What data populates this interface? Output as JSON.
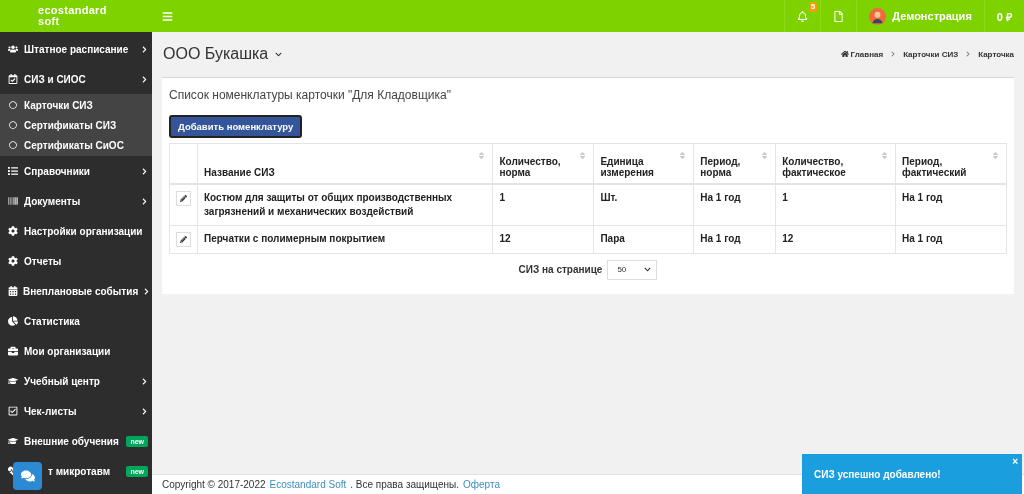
{
  "header": {
    "logo": [
      "ecostandard",
      "soft"
    ],
    "notifications_badge": "5",
    "user": "Демонстрация",
    "balance": "0 ₽"
  },
  "sidebar": {
    "items": [
      {
        "label": "Штатное расписание",
        "arrow": true
      },
      {
        "label": "СИЗ и СИОС",
        "arrow": true,
        "children": [
          {
            "label": "Карточки СИЗ"
          },
          {
            "label": "Сертификаты СИЗ"
          },
          {
            "label": "Сертификаты СиОС"
          }
        ]
      },
      {
        "label": "Справочники",
        "arrow": true
      },
      {
        "label": "Документы",
        "arrow": true
      },
      {
        "label": "Настройки организации",
        "arrow": false
      },
      {
        "label": "Отчеты",
        "arrow": false
      },
      {
        "label": "Внеплановые события",
        "arrow": true
      },
      {
        "label": "Статистика",
        "arrow": false
      },
      {
        "label": "Мои организации",
        "arrow": false
      },
      {
        "label": "Учебный центр",
        "arrow": true
      },
      {
        "label": "Чек-листы",
        "arrow": true
      },
      {
        "label": "Внешние обучения",
        "arrow": false,
        "badge": "new"
      },
      {
        "label": "т микротавм",
        "arrow": false,
        "badge": "new"
      }
    ]
  },
  "page": {
    "title": "ООО Букашка",
    "breadcrumbs": [
      "Главная",
      "Карточки СИЗ",
      "Карточка"
    ]
  },
  "card": {
    "title": "Список номенклатуры карточки \"Для Кладовщика\"",
    "add_button": "Добавить номенклатуру",
    "table": {
      "columns": [
        "Название СИЗ",
        "Количество, норма",
        "Единица измерения",
        "Период, норма",
        "Количество, фактическое",
        "Период, фактический"
      ],
      "rows": [
        [
          "Костюм для защиты от общих производственных загрязнений и механических воздействий",
          "1",
          "Шт.",
          "На 1 год",
          "1",
          "На 1 год"
        ],
        [
          "Перчатки с полимерным покрытием",
          "12",
          "Пара",
          "На 1 год",
          "12",
          "На 1 год"
        ]
      ]
    },
    "pager": {
      "label": "СИЗ на странице",
      "value": "50"
    }
  },
  "footer": {
    "text": "Copyright © 2017-2022",
    "link": "Ecostandard Soft",
    "rights": ". Все права защищены.",
    "offer": "Оферта"
  },
  "toast": {
    "message": "СИЗ успешно добавлено!",
    "close": "×"
  }
}
